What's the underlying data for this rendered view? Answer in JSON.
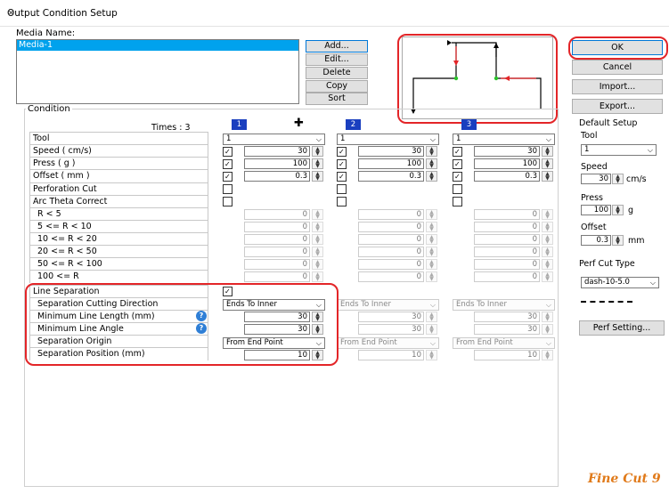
{
  "window": {
    "title": "Output Condition Setup"
  },
  "media": {
    "label": "Media Name:",
    "items": [
      "Media-1"
    ],
    "buttons": [
      "Add...",
      "Edit...",
      "Delete",
      "Copy",
      "Sort"
    ]
  },
  "side": {
    "ok": "OK",
    "cancel": "Cancel",
    "import": "Import...",
    "export": "Export...",
    "default_setup": "Default Setup",
    "tool_label": "Tool",
    "tool_value": "1",
    "speed_label": "Speed",
    "speed_value": "30",
    "speed_unit": "cm/s",
    "press_label": "Press",
    "press_value": "100",
    "press_unit": "g",
    "offset_label": "Offset",
    "offset_value": "0.3",
    "offset_unit": "mm",
    "perf_label": "Perf Cut Type",
    "perf_value": "dash-10-5.0",
    "perf_setting": "Perf Setting..."
  },
  "condition": {
    "label": "Condition",
    "times": "Times : 3",
    "rows": [
      "Tool",
      "Speed ( cm/s)",
      "Press ( g )",
      "Offset ( mm )",
      "Perforation Cut",
      "Arc Theta Correct",
      "R < 5",
      "5 <= R < 10",
      "10 <= R < 20",
      "20 <= R < 50",
      "50 <= R < 100",
      "100 <= R",
      "Line Separation",
      "Separation Cutting Direction",
      "Minimum Line Length (mm)",
      "Minimum Line Angle",
      "Separation Origin",
      "Separation Position (mm)"
    ],
    "columns": [
      {
        "num": "1",
        "tool": "1",
        "speed": "30",
        "press": "100",
        "offset": "0.3",
        "r": [
          "0",
          "0",
          "0",
          "0",
          "0",
          "0"
        ],
        "dir": "Ends To Inner",
        "minlen": "30",
        "minang": "30",
        "origin": "From End Point",
        "pos": "10"
      },
      {
        "num": "2",
        "tool": "1",
        "speed": "30",
        "press": "100",
        "offset": "0.3",
        "r": [
          "0",
          "0",
          "0",
          "0",
          "0",
          "0"
        ],
        "dir": "Ends To Inner",
        "minlen": "30",
        "minang": "30",
        "origin": "From End Point",
        "pos": "10"
      },
      {
        "num": "3",
        "tool": "1",
        "speed": "30",
        "press": "100",
        "offset": "0.3",
        "r": [
          "0",
          "0",
          "0",
          "0",
          "0",
          "0"
        ],
        "dir": "Ends To Inner",
        "minlen": "30",
        "minang": "30",
        "origin": "From End Point",
        "pos": "10"
      }
    ]
  },
  "logo": "Fine Cut 9",
  "colors": {
    "accent": "#00a2ed",
    "highlight": "#e32528",
    "header": "#1a3fbf"
  }
}
